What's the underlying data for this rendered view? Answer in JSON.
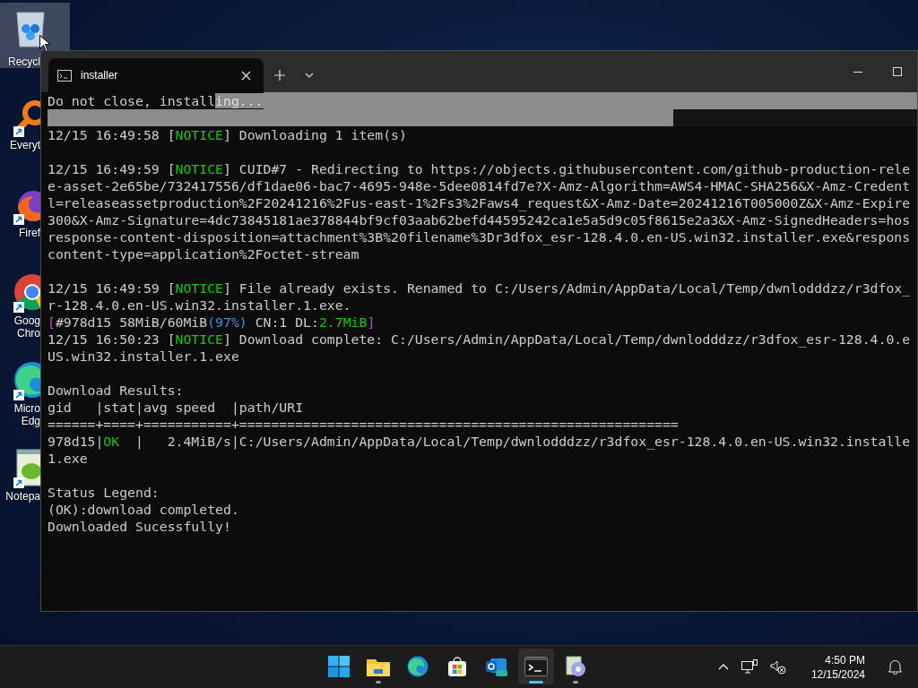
{
  "desktop": {
    "icons": [
      {
        "kind": "recycle-bin",
        "label": [
          "Recycl"
        ],
        "selected": true,
        "shortcut": false
      },
      {
        "kind": "magnifier",
        "label": [
          "Everyt"
        ],
        "selected": false,
        "shortcut": true
      },
      {
        "kind": "flame-globe",
        "label": [
          "Firef"
        ],
        "selected": false,
        "shortcut": true
      },
      {
        "kind": "tricolor",
        "label": [
          "Goog",
          "Chro"
        ],
        "selected": false,
        "shortcut": true
      },
      {
        "kind": "wave",
        "label": [
          "Micro",
          "Edg"
        ],
        "selected": false,
        "shortcut": true
      },
      {
        "kind": "notepad",
        "label": [
          "Notepa"
        ],
        "selected": false,
        "shortcut": true
      }
    ]
  },
  "window": {
    "tab": {
      "title": "installer",
      "selected": true
    },
    "terminal": {
      "lines": [
        {
          "segments": [
            {
              "text": "Do not close, install"
            },
            {
              "text": "ing...",
              "kind": "highlight"
            }
          ],
          "highlight_rest": true
        },
        {
          "kind": "bar",
          "level": 0.72
        },
        {
          "segments": [
            {
              "text": "12/15 16:49:58 ["
            },
            {
              "text": "NOTICE",
              "kind": "notice"
            },
            {
              "text": "] Downloading 1 item(s)"
            }
          ]
        },
        {
          "kind": "blank"
        },
        {
          "segments": [
            {
              "text": "12/15 16:49:59 ["
            },
            {
              "text": "NOTICE",
              "kind": "notice"
            },
            {
              "text": "] CUID#7 - Redirecting to https://objects.githubusercontent.com/github-production-rele"
            }
          ]
        },
        {
          "segments": [
            {
              "text": "e-asset-2e65be/732417556/df1dae06-bac7-4695-948e-5dee0814fd7e?X-Amz-Algorithm=AWS4-HMAC-SHA256&X-Amz-Credent"
            }
          ]
        },
        {
          "segments": [
            {
              "text": "l=releaseassetproduction%2F20241216%2Fus-east-1%2Fs3%2Faws4_request&X-Amz-Date=20241216T005000Z&X-Amz-Expire"
            }
          ]
        },
        {
          "segments": [
            {
              "text": "300&X-Amz-Signature=4dc73845181ae378844bf9cf03aab62befd44595242ca1e5a5d9c05f8615e2a3&X-Amz-SignedHeaders=hos"
            }
          ]
        },
        {
          "segments": [
            {
              "text": "response-content-disposition=attachment%3B%20filename%3Dr3dfox_esr-128.4.0.en-US.win32.installer.exe&respons"
            }
          ]
        },
        {
          "segments": [
            {
              "text": "content-type=application%2Foctet-stream"
            }
          ]
        },
        {
          "kind": "blank"
        },
        {
          "segments": [
            {
              "text": "12/15 16:49:59 ["
            },
            {
              "text": "NOTICE",
              "kind": "notice"
            },
            {
              "text": "] File already exists. Renamed to C:/Users/Admin/AppData/Local/Temp/dwnlodddzz/r3dfox_"
            }
          ]
        },
        {
          "segments": [
            {
              "text": "r-128.4.0.en-US.win32.installer.1.exe."
            }
          ]
        },
        {
          "segments": [
            {
              "text": "[",
              "kind": "bracket"
            },
            {
              "text": "#978d15 58MiB/60MiB"
            },
            {
              "text": "(97%)",
              "kind": "percent"
            },
            {
              "text": " CN:1 DL:"
            },
            {
              "text": "2.7MiB",
              "kind": "speed"
            },
            {
              "text": "]",
              "kind": "bracket"
            }
          ]
        },
        {
          "segments": [
            {
              "text": "12/15 16:50:23 ["
            },
            {
              "text": "NOTICE",
              "kind": "notice"
            },
            {
              "text": "] Download complete: C:/Users/Admin/AppData/Local/Temp/dwnlodddzz/r3dfox_esr-128.4.0.e"
            }
          ]
        },
        {
          "segments": [
            {
              "text": "US.win32.installer.1.exe"
            }
          ]
        },
        {
          "kind": "blank"
        },
        {
          "segments": [
            {
              "text": "Download Results:"
            }
          ]
        },
        {
          "segments": [
            {
              "text": "gid   |stat|avg speed  |path/URI"
            }
          ]
        },
        {
          "segments": [
            {
              "text": "======+====+===========+======================================================="
            }
          ]
        },
        {
          "segments": [
            {
              "text": "978d15|"
            },
            {
              "text": "OK",
              "kind": "speed"
            },
            {
              "text": "  |   2.4MiB/s|C:/Users/Admin/AppData/Local/Temp/dwnlodddzz/r3dfox_esr-128.4.0.en-US.win32.installe"
            }
          ]
        },
        {
          "segments": [
            {
              "text": "1.exe"
            }
          ]
        },
        {
          "kind": "blank"
        },
        {
          "segments": [
            {
              "text": "Status Legend:"
            }
          ]
        },
        {
          "segments": [
            {
              "text": "(OK):download completed."
            }
          ]
        },
        {
          "segments": [
            {
              "text": "Downloaded Sucessfully!"
            }
          ]
        }
      ]
    }
  },
  "taskbar": {
    "apps": [
      {
        "kind": "start",
        "selected": false,
        "running": false
      },
      {
        "kind": "folder",
        "selected": false,
        "running": true
      },
      {
        "kind": "browser",
        "selected": false,
        "running": false
      },
      {
        "kind": "store",
        "selected": false,
        "running": false
      },
      {
        "kind": "mail",
        "selected": false,
        "running": false
      },
      {
        "kind": "terminal",
        "selected": true,
        "running": true
      },
      {
        "kind": "installer",
        "selected": false,
        "running": true
      }
    ],
    "clock": {
      "time": "4:50 PM",
      "date": "12/15/2024"
    }
  }
}
